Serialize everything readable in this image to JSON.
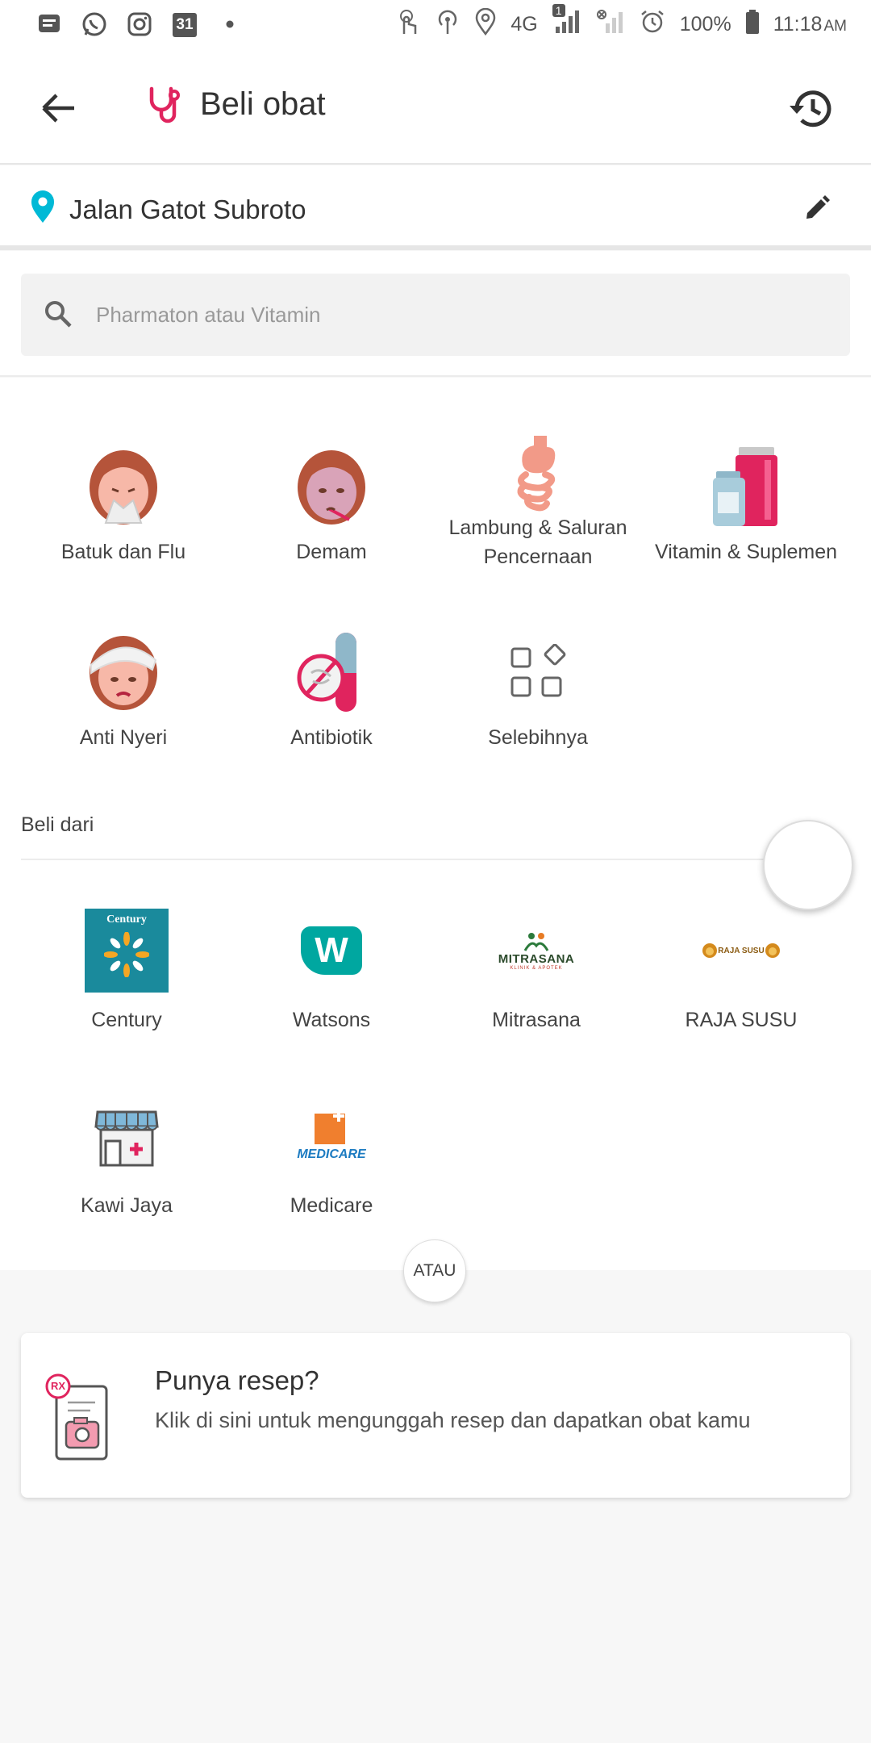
{
  "status_bar": {
    "calendar_day": "31",
    "network": "4G",
    "notif_count": "1",
    "battery": "100%",
    "time": "11:18",
    "ampm": "AM"
  },
  "appbar": {
    "title": "Beli obat"
  },
  "location": {
    "address": "Jalan Gatot Subroto"
  },
  "search": {
    "placeholder": "Pharmaton atau Vitamin"
  },
  "categories": [
    {
      "label": "Batuk dan Flu",
      "icon": "cough-flu-icon"
    },
    {
      "label": "Demam",
      "icon": "fever-icon"
    },
    {
      "label": "Lambung & Saluran Pencernaan",
      "icon": "digestive-icon"
    },
    {
      "label": "Vitamin & Suplemen",
      "icon": "vitamin-icon"
    },
    {
      "label": "Anti Nyeri",
      "icon": "pain-relief-icon"
    },
    {
      "label": "Antibiotik",
      "icon": "antibiotic-icon"
    },
    {
      "label": "Selebihnya",
      "icon": "more-grid-icon"
    }
  ],
  "beli_dari": {
    "title": "Beli dari",
    "stores": [
      {
        "label": "Century",
        "logo_text": "Century"
      },
      {
        "label": "Watsons",
        "logo_text": "W"
      },
      {
        "label": "Mitrasana",
        "logo_text": "MITRASANA",
        "logo_sub": "KLINIK & APOTEK"
      },
      {
        "label": "RAJA SUSU",
        "logo_text": "RAJA SUSU"
      },
      {
        "label": "Kawi Jaya"
      },
      {
        "label": "Medicare",
        "logo_text": "MEDICARE"
      }
    ]
  },
  "divider_label": "ATAU",
  "resep": {
    "badge": "RX",
    "title": "Punya resep?",
    "description": "Klik di sini untuk mengunggah resep dan dapatkan obat kamu"
  },
  "colors": {
    "brand_pink": "#e0245e",
    "location_pin": "#00b9d6",
    "century_teal": "#1a8a9c",
    "watsons_teal": "#00a7a0",
    "medicare_orange": "#f07f2e",
    "medicare_blue": "#1c7bc1"
  }
}
